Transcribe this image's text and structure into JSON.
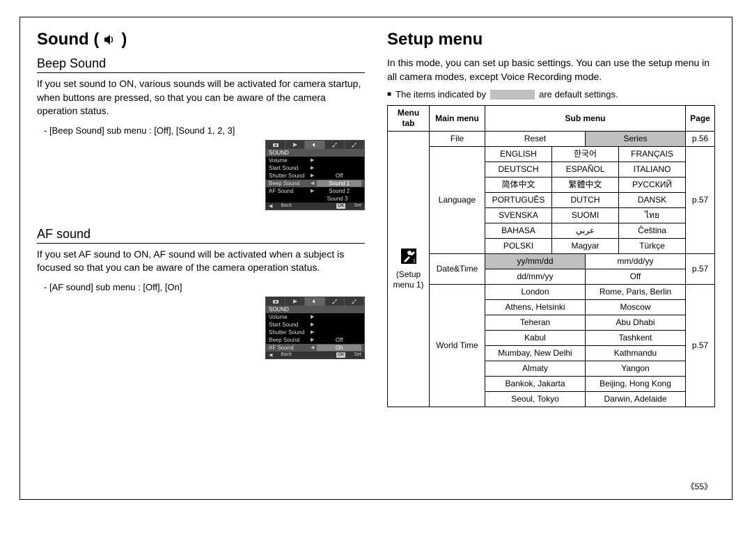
{
  "left": {
    "heading": "Sound (",
    "heading_close": ")",
    "sections": {
      "beep": {
        "title": "Beep Sound",
        "body": "If you set sound to ON, various sounds will be activated for camera startup, when buttons are pressed, so that you can be aware of the camera operation status.",
        "submenu": "- [Beep Sound] sub menu : [Off], [Sound 1, 2, 3]"
      },
      "af": {
        "title": "AF sound",
        "body": "If you set AF sound to ON, AF sound will be activated when a subject is focused so that you can be aware of the camera operation status.",
        "submenu": "- [AF sound] sub menu : [Off], [On]"
      }
    },
    "lcd1": {
      "title": "SOUND",
      "rows": [
        {
          "label": "Volume",
          "arrow": "▶",
          "opt": ""
        },
        {
          "label": "Start Sound",
          "arrow": "▶",
          "opt": ""
        },
        {
          "label": "Shutter Sound",
          "arrow": "▶",
          "opt": "Off"
        },
        {
          "label": "Beep Sound",
          "arrow": "◀",
          "opt": "Sound 1",
          "sel": true
        },
        {
          "label": "AF Sound",
          "arrow": "▶",
          "opt": "Sound 2"
        },
        {
          "label": "",
          "arrow": "",
          "opt": "Sound 3"
        }
      ],
      "footer_back": "Back",
      "footer_ok": "OK",
      "footer_set": "Set"
    },
    "lcd2": {
      "title": "SOUND",
      "rows": [
        {
          "label": "Volume",
          "arrow": "▶",
          "opt": ""
        },
        {
          "label": "Start Sound",
          "arrow": "▶",
          "opt": ""
        },
        {
          "label": "Shutter Sound",
          "arrow": "▶",
          "opt": ""
        },
        {
          "label": "Beep Sound",
          "arrow": "▶",
          "opt": "Off"
        },
        {
          "label": "AF Sound",
          "arrow": "◀",
          "opt": "On",
          "sel": true
        }
      ],
      "footer_back": "Back",
      "footer_ok": "OK",
      "footer_set": "Set"
    }
  },
  "right": {
    "heading": "Setup menu",
    "intro": "In this mode, you can set up basic settings. You can use the setup menu in all camera modes, except Voice Recording mode.",
    "note_prefix": "The items indicated by",
    "note_suffix": "are default settings.",
    "table": {
      "headers": {
        "menutab": "Menu tab",
        "main": "Main menu",
        "sub": "Sub menu",
        "page": "Page"
      },
      "menutab_label": "(Setup menu 1)",
      "rows": {
        "file": {
          "main": "File",
          "subs": [
            "Reset",
            "Series"
          ],
          "default_idx": 1,
          "page": "p.56"
        },
        "language": {
          "main": "Language",
          "grid": [
            [
              "ENGLISH",
              "한국어",
              "FRANÇAIS"
            ],
            [
              "DEUTSCH",
              "ESPAÑOL",
              "ITALIANO"
            ],
            [
              "简体中文",
              "繁體中文",
              "РУССКИЙ"
            ],
            [
              "PORTUGUÊS",
              "DUTCH",
              "DANSK"
            ],
            [
              "SVENSKA",
              "SUOMI",
              "ไทย"
            ],
            [
              "BAHASA",
              "عربي",
              "Čeština"
            ],
            [
              "POLSKI",
              "Magyar",
              "Türkçe"
            ]
          ],
          "page": "p.57"
        },
        "datetime": {
          "main": "Date&Time",
          "subs_top": [
            "yy/mm/dd",
            "mm/dd/yy"
          ],
          "default_top_idx": 0,
          "subs_bot": [
            "dd/mm/yy",
            "Off"
          ],
          "page": "p.57"
        },
        "worldtime": {
          "main": "World Time",
          "pairs": [
            [
              "London",
              "Rome, Paris, Berlin"
            ],
            [
              "Athens, Helsinki",
              "Moscow"
            ],
            [
              "Teheran",
              "Abu Dhabi"
            ],
            [
              "Kabul",
              "Tashkent"
            ],
            [
              "Mumbay, New Delhi",
              "Kathmandu"
            ],
            [
              "Almaty",
              "Yangon"
            ],
            [
              "Bankok, Jakarta",
              "Beijing, Hong Kong"
            ],
            [
              "Seoul, Tokyo",
              "Darwin, Adelaide"
            ]
          ],
          "page": "p.57"
        }
      }
    }
  },
  "page_number": "《55》"
}
